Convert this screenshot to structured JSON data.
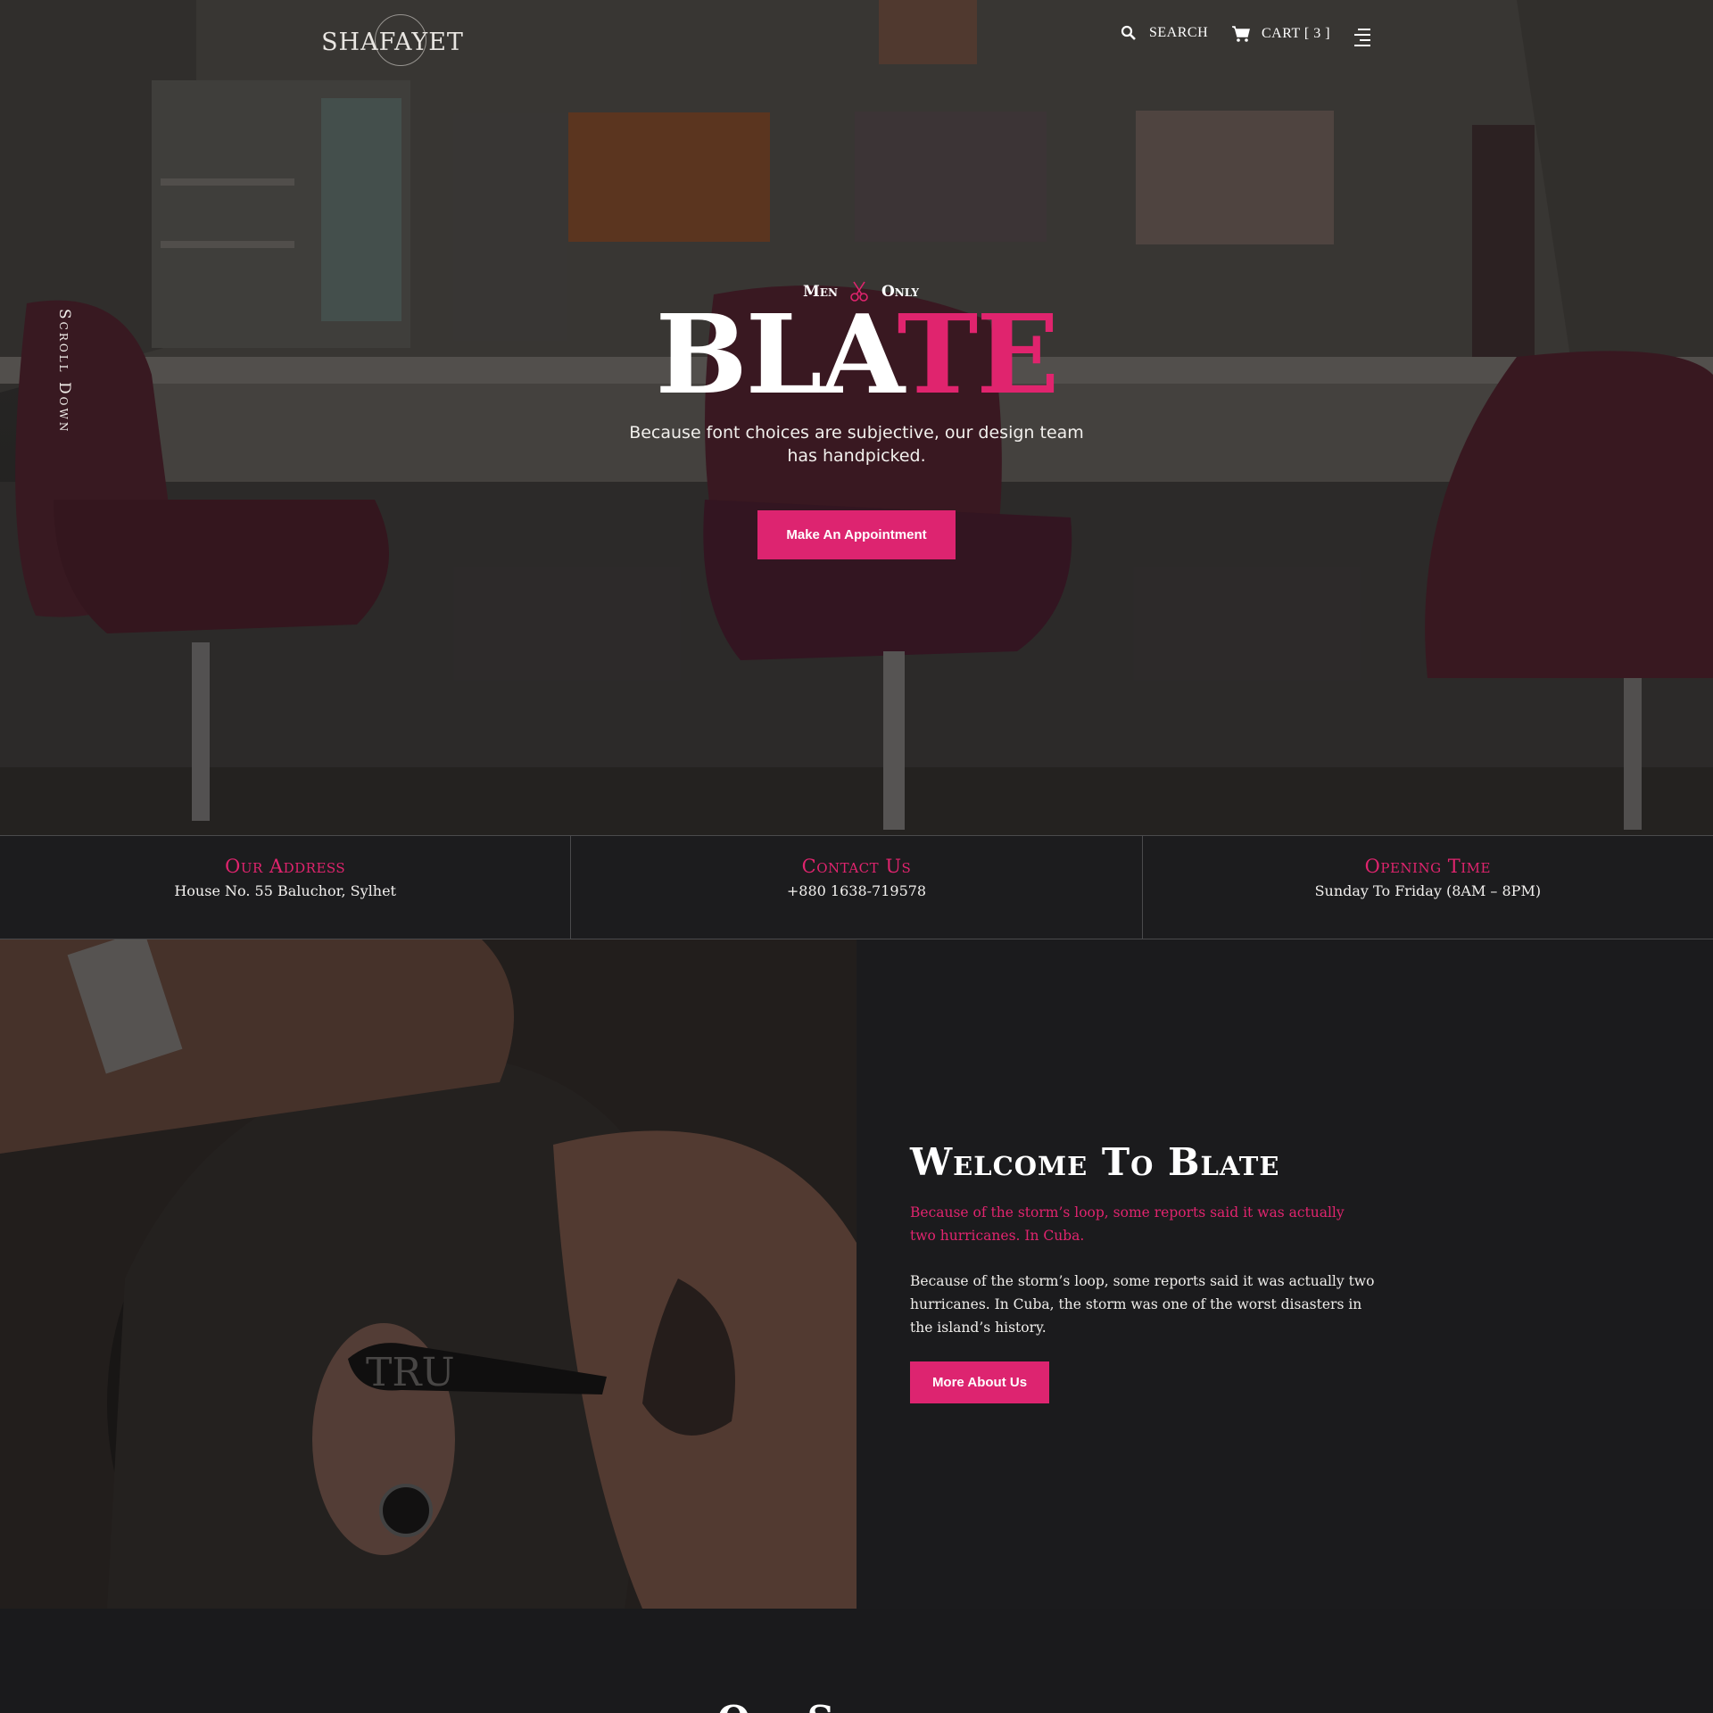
{
  "header": {
    "logo_text": "SHAFAYET",
    "search_label": "SEARCH",
    "cart_label": "CART [ 3 ]"
  },
  "hero": {
    "scroll_label": "Scroll Down",
    "tagline_left": "Men",
    "tagline_right": "Only",
    "title_main": "BLA",
    "title_accent": "TE",
    "subtitle": "Because font choices are subjective, our design team has handpicked.",
    "cta_label": "Make An Appointment"
  },
  "info": [
    {
      "label": "Our Address",
      "value": "House No. 55 Baluchor, Sylhet"
    },
    {
      "label": "Contact Us",
      "value": "+880 1638-719578"
    },
    {
      "label": "Opening Time",
      "value": "Sunday To Friday (8AM – 8PM)"
    }
  ],
  "about": {
    "heading": "Welcome To Blate",
    "lead": "Because of the storm’s loop, some reports said it was actually two hurricanes. In Cuba.",
    "body": "Because of the storm’s loop, some reports said it was actually two hurricanes. In Cuba, the storm was one of the worst disasters in the island’s history.",
    "cta_label": "More About Us"
  },
  "next_section": {
    "heading_partial": "Our S"
  },
  "colors": {
    "accent": "#dd2470",
    "background": "#1b1b1d"
  },
  "icons": {
    "search": "magnifier-icon",
    "cart": "cart-icon",
    "menu": "menu-lines-icon",
    "tagline": "scissors-icon"
  }
}
